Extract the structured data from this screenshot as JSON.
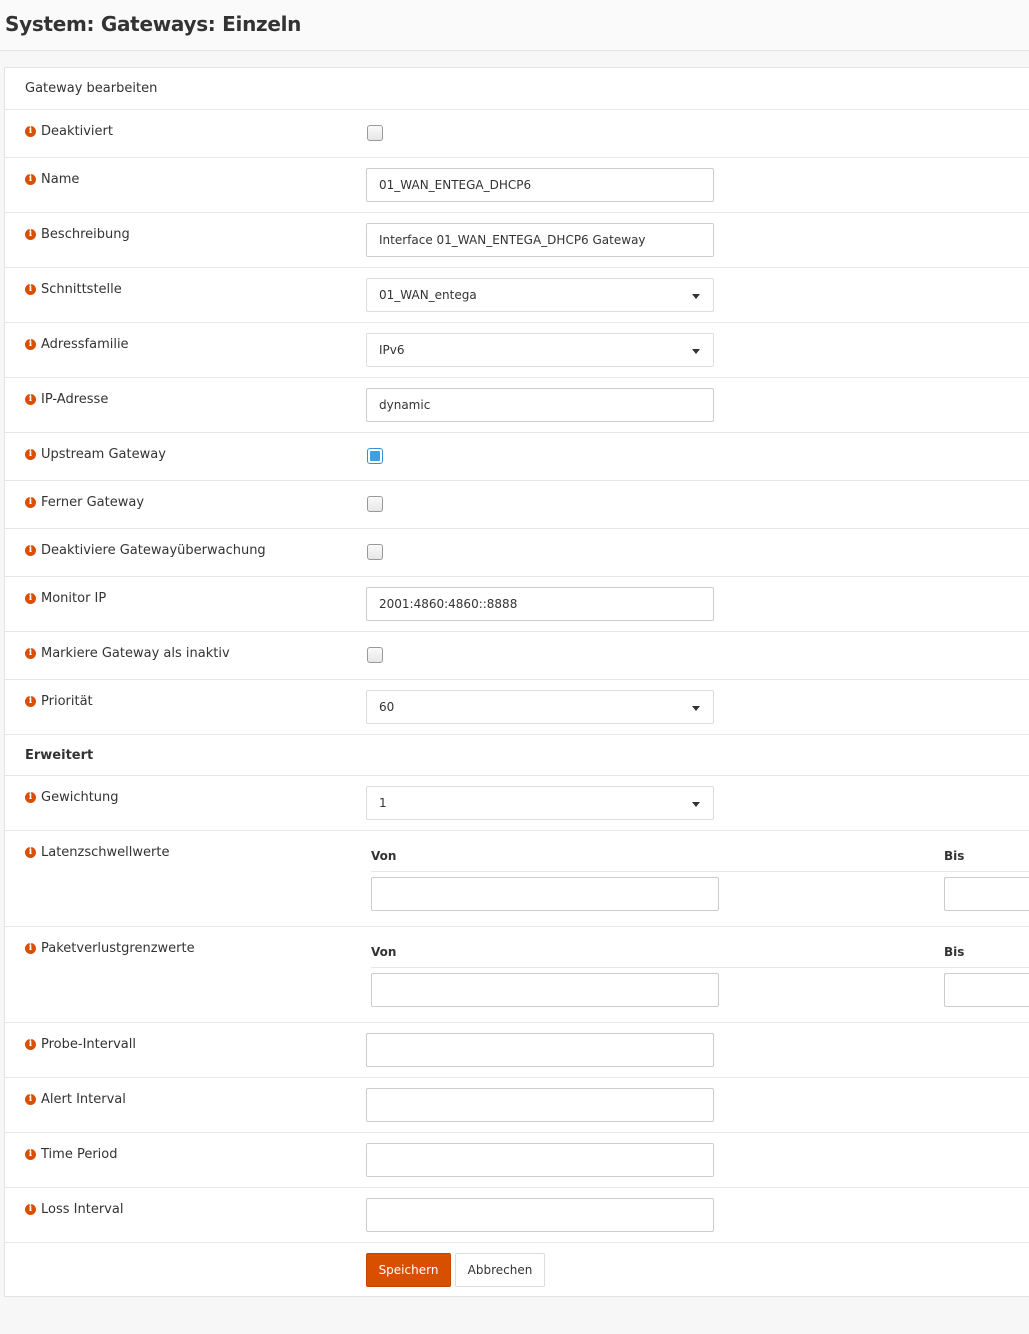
{
  "page": {
    "title": "System: Gateways: Einzeln"
  },
  "panel": {
    "header": "Gateway bearbeiten",
    "advanced_header": "Erweitert"
  },
  "fields": {
    "disabled": {
      "label": "Deaktiviert",
      "checked": false
    },
    "name": {
      "label": "Name",
      "value": "01_WAN_ENTEGA_DHCP6"
    },
    "description": {
      "label": "Beschreibung",
      "value": "Interface 01_WAN_ENTEGA_DHCP6 Gateway"
    },
    "interface": {
      "label": "Schnittstelle",
      "value": "01_WAN_entega"
    },
    "address_family": {
      "label": "Adressfamilie",
      "value": "IPv6"
    },
    "ip_address": {
      "label": "IP-Adresse",
      "value": "dynamic"
    },
    "upstream_gateway": {
      "label": "Upstream Gateway",
      "checked": true
    },
    "far_gateway": {
      "label": "Ferner Gateway",
      "checked": false
    },
    "disable_monitoring": {
      "label": "Deaktiviere Gatewayüberwachung",
      "checked": false
    },
    "monitor_ip": {
      "label": "Monitor IP",
      "value": "2001:4860:4860::8888"
    },
    "mark_inactive": {
      "label": "Markiere Gateway als inaktiv",
      "checked": false
    },
    "priority": {
      "label": "Priorität",
      "value": "60"
    },
    "weight": {
      "label": "Gewichtung",
      "value": "1"
    },
    "latency": {
      "label": "Latenzschwellwerte",
      "from_label": "Von",
      "to_label": "Bis",
      "from_value": "",
      "to_value": ""
    },
    "loss": {
      "label": "Paketverlustgrenzwerte",
      "from_label": "Von",
      "to_label": "Bis",
      "from_value": "",
      "to_value": ""
    },
    "probe_interval": {
      "label": "Probe-Intervall",
      "value": ""
    },
    "alert_interval": {
      "label": "Alert Interval",
      "value": ""
    },
    "time_period": {
      "label": "Time Period",
      "value": ""
    },
    "loss_interval": {
      "label": "Loss Interval",
      "value": ""
    }
  },
  "buttons": {
    "save": "Speichern",
    "cancel": "Abbrechen"
  },
  "colors": {
    "accent": "#d94f00",
    "checkbox_checked": "#3aa0e8"
  },
  "icons": {
    "info": "info-circle-icon"
  }
}
